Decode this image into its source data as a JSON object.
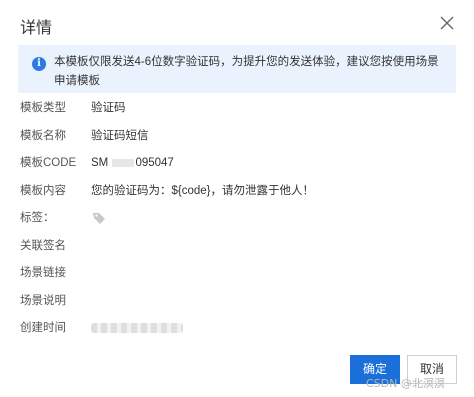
{
  "dialog": {
    "title": "详情",
    "notice": "本模板仅限发送4-6位数字验证码，为提升您的发送体验，建议您按使用场景申请模板",
    "fields": [
      {
        "label": "模板类型",
        "value": "验证码"
      },
      {
        "label": "模板名称",
        "value": "验证码短信"
      },
      {
        "label": "模板CODE",
        "value_prefix": "SM",
        "value_suffix": "095047"
      },
      {
        "label": "模板内容",
        "value": "您的验证码为：${code}，请勿泄露于他人！"
      },
      {
        "label": "标签：",
        "value": ""
      },
      {
        "label": "关联签名",
        "value": ""
      },
      {
        "label": "场景链接",
        "value": ""
      },
      {
        "label": "场景说明",
        "value": ""
      },
      {
        "label": "创建时间",
        "value": ""
      }
    ],
    "buttons": {
      "ok": "确定",
      "cancel": "取消"
    },
    "accent_color": "#1a6fd8",
    "notice_bg": "#eaf3fd",
    "icons": [
      "close-icon",
      "info-icon",
      "tag-icon"
    ]
  },
  "watermark": "CSDN @北溟溟"
}
